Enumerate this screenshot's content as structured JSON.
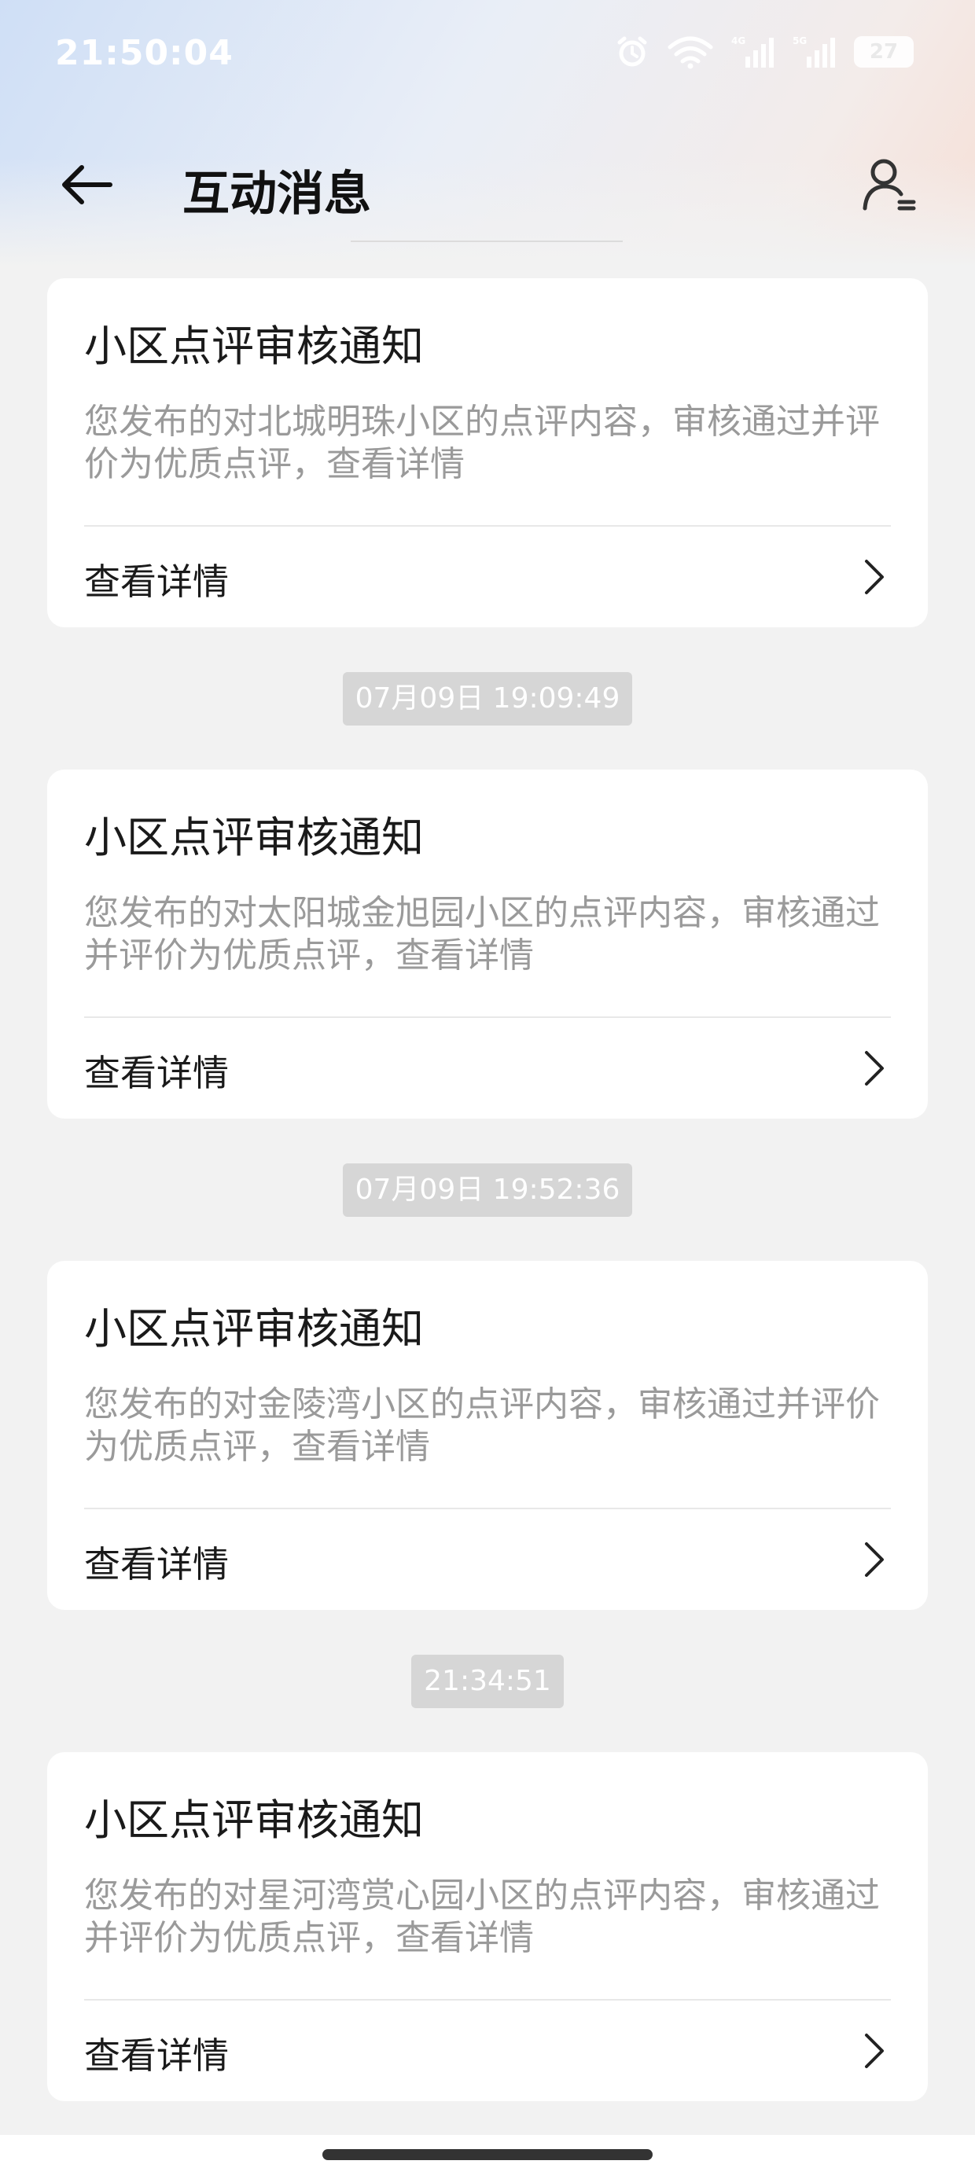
{
  "status_bar": {
    "time": "21:50:04",
    "battery_level": "27",
    "icons": [
      "alarm-icon",
      "wifi-icon",
      "4g-signal-icon",
      "5g-signal-icon",
      "battery-icon"
    ]
  },
  "header": {
    "title": "互动消息",
    "back_icon": "arrow-left-icon",
    "profile_icon": "user-list-icon"
  },
  "messages": [
    {
      "title": "小区点评审核通知",
      "body": "您发布的对北城明珠小区的点评内容，审核通过并评价为优质点评，查看详情",
      "action_label": "查看详情"
    },
    {
      "timestamp": "07月09日 19:09:49",
      "title": "小区点评审核通知",
      "body": "您发布的对太阳城金旭园小区的点评内容，审核通过并评价为优质点评，查看详情",
      "action_label": "查看详情"
    },
    {
      "timestamp": "07月09日 19:52:36",
      "title": "小区点评审核通知",
      "body": "您发布的对金陵湾小区的点评内容，审核通过并评价为优质点评，查看详情",
      "action_label": "查看详情"
    },
    {
      "timestamp": "21:34:51",
      "title": "小区点评审核通知",
      "body": "您发布的对星河湾赏心园小区的点评内容，审核通过并评价为优质点评，查看详情",
      "action_label": "查看详情"
    }
  ],
  "colors": {
    "background": "#f2f2f2",
    "card": "#ffffff",
    "body_text": "#9a9a9a",
    "timestamp_bg": "#d6d6d6"
  }
}
